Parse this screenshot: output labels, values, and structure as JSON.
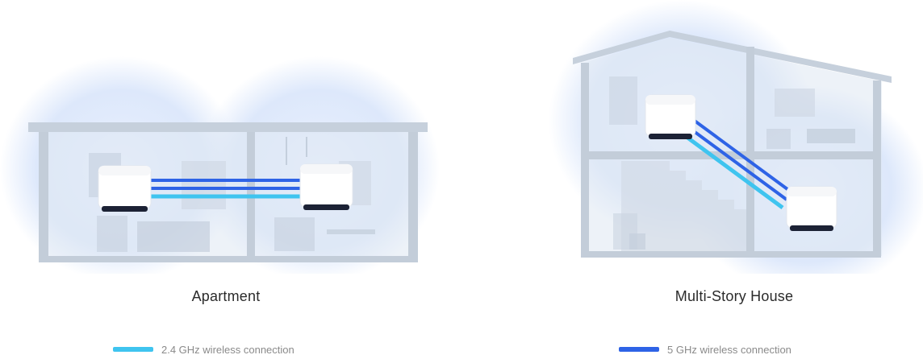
{
  "scenes": [
    {
      "caption": "Apartment"
    },
    {
      "caption": "Multi-Story House"
    }
  ],
  "legend": [
    {
      "label": "2.4 GHz wireless connection",
      "color": "#3fc4ef"
    },
    {
      "label": "5 GHz wireless connection",
      "color": "#2e63e6"
    }
  ],
  "colors": {
    "signal_glow": "#dfe9fb",
    "wall": "#bcc8d6",
    "node_body": "#ffffff",
    "node_base": "#1c2235"
  }
}
